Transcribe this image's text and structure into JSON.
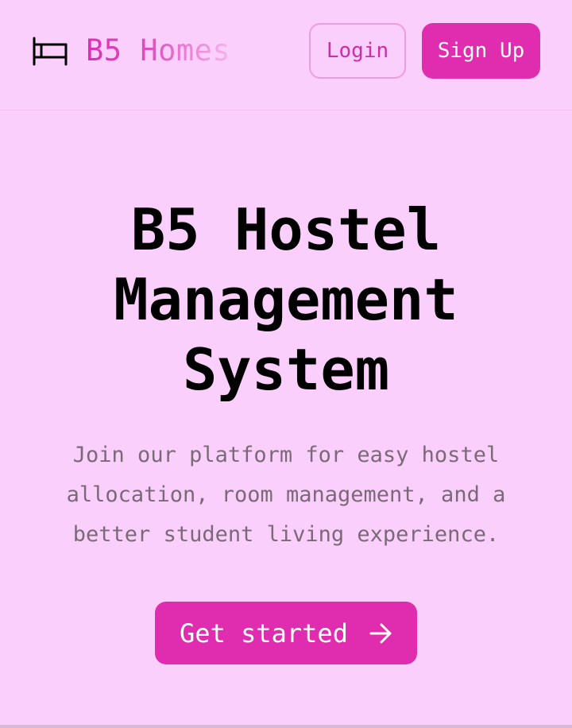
{
  "header": {
    "brand_icon": "bed-icon",
    "brand_name": "B5 Homes",
    "login_label": "Login",
    "signup_label": "Sign Up"
  },
  "hero": {
    "title_lines": [
      "B5 Hostel",
      "Management",
      "System"
    ],
    "subtitle_lines": [
      "Join our platform for easy hostel",
      "allocation, room management, and a",
      "better student living experience."
    ],
    "cta_label": "Get started",
    "cta_icon": "arrow-right-icon"
  },
  "colors": {
    "background": "#fbcffb",
    "accent": "#e02daf",
    "subtitle_text": "#7a6a78"
  }
}
